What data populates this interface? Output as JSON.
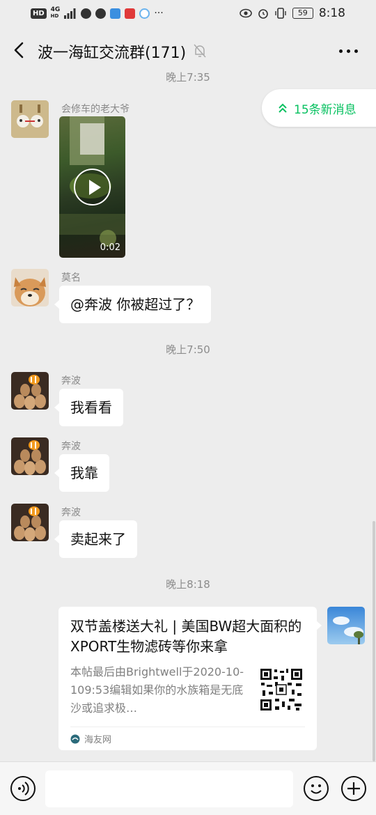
{
  "status": {
    "hd": "HD",
    "net_top": "4G",
    "net_bottom": "HD",
    "battery": "59",
    "time": "8:18",
    "more": "···"
  },
  "chat": {
    "title": "波一海缸交流群(171)",
    "new_messages_label": "15条新消息"
  },
  "messages": [
    {
      "type": "timestamp",
      "text": "晚上7:35"
    },
    {
      "type": "video",
      "sender": "会修车的老大爷",
      "duration": "0:02"
    },
    {
      "type": "text",
      "sender": "莫名",
      "text": "@奔波  你被超过了？"
    },
    {
      "type": "timestamp",
      "text": "晚上7:50"
    },
    {
      "type": "text",
      "sender": "奔波",
      "text": "我看看"
    },
    {
      "type": "text",
      "sender": "奔波",
      "text": "我靠"
    },
    {
      "type": "text",
      "sender": "奔波",
      "text": "卖起来了"
    },
    {
      "type": "timestamp",
      "text": "晚上8:18"
    },
    {
      "type": "link_card",
      "title": "双节盖楼送大礼 | 美国BW超大面积的XPORT生物滤砖等你来拿",
      "desc": "本帖最后由Brightwell于2020-10-109:53编辑如果你的水族箱是无底沙或追求极…",
      "source": "海友网"
    }
  ],
  "colors": {
    "accent_green": "#07c160",
    "background": "#ededed",
    "bubble": "#ffffff"
  }
}
